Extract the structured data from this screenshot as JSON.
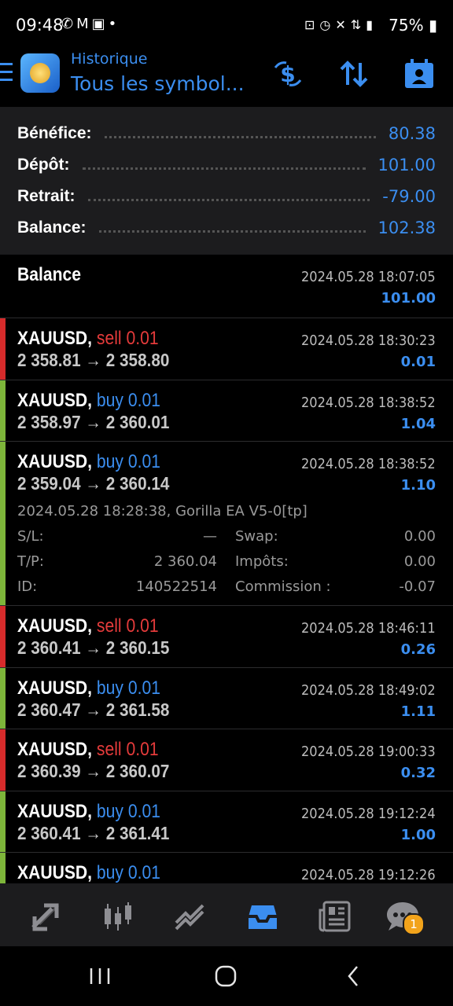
{
  "status_bar": {
    "time": "09:48",
    "battery": "75%",
    "left_icons": [
      "whatsapp-icon",
      "gmail-icon",
      "gallery-icon",
      "dot-icon"
    ],
    "right_icons": [
      "lock-icon",
      "alarm-icon",
      "mute-icon",
      "4g-icon",
      "signal-icon",
      "battery-icon"
    ]
  },
  "header": {
    "subtitle": "Historique",
    "title": "Tous les symbol...",
    "accent": "#3b8ef0"
  },
  "summary": [
    {
      "label": "Bénéfice:",
      "value": "80.38"
    },
    {
      "label": "Dépôt:",
      "value": "101.00"
    },
    {
      "label": "Retrait:",
      "value": "-79.00"
    },
    {
      "label": "Balance:",
      "value": "102.38"
    }
  ],
  "balance_entry": {
    "label": "Balance",
    "date": "2024.05.28 18:07:05",
    "amount": "101.00"
  },
  "trades": [
    {
      "symbol": "XAUUSD,",
      "action": "sell 0.01",
      "side": "sell",
      "open": "2 358.81",
      "close": "2 358.80",
      "date": "2024.05.28 18:30:23",
      "profit": "0.01"
    },
    {
      "symbol": "XAUUSD,",
      "action": "buy 0.01",
      "side": "buy",
      "open": "2 358.97",
      "close": "2 360.01",
      "date": "2024.05.28 18:38:52",
      "profit": "1.04"
    },
    {
      "symbol": "XAUUSD,",
      "action": "buy 0.01",
      "side": "buy",
      "open": "2 359.04",
      "close": "2 360.14",
      "date": "2024.05.28 18:38:52",
      "profit": "1.10",
      "details": {
        "comment": "2024.05.28 18:28:38, Gorilla EA V5-0[tp]",
        "sl_label": "S/L:",
        "sl_value": "—",
        "tp_label": "T/P:",
        "tp_value": "2 360.04",
        "id_label": "ID:",
        "id_value": "140522514",
        "swap_label": "Swap:",
        "swap_value": "0.00",
        "tax_label": "Impôts:",
        "tax_value": "0.00",
        "commission_label": "Commission :",
        "commission_value": "-0.07"
      }
    },
    {
      "symbol": "XAUUSD,",
      "action": "sell 0.01",
      "side": "sell",
      "open": "2 360.41",
      "close": "2 360.15",
      "date": "2024.05.28 18:46:11",
      "profit": "0.26"
    },
    {
      "symbol": "XAUUSD,",
      "action": "buy 0.01",
      "side": "buy",
      "open": "2 360.47",
      "close": "2 361.58",
      "date": "2024.05.28 18:49:02",
      "profit": "1.11"
    },
    {
      "symbol": "XAUUSD,",
      "action": "sell 0.01",
      "side": "sell",
      "open": "2 360.39",
      "close": "2 360.07",
      "date": "2024.05.28 19:00:33",
      "profit": "0.32"
    },
    {
      "symbol": "XAUUSD,",
      "action": "buy 0.01",
      "side": "buy",
      "open": "2 360.41",
      "close": "2 361.41",
      "date": "2024.05.28 19:12:24",
      "profit": "1.00"
    },
    {
      "symbol": "XAUUSD,",
      "action": "buy 0.01",
      "side": "buy",
      "open": "",
      "close": "",
      "date": "2024.05.28 19:12:26",
      "profit": ""
    }
  ],
  "bottom_nav": {
    "items": [
      "quotes-icon",
      "chart-icon",
      "trade-icon",
      "history-icon",
      "news-icon",
      "chat-icon"
    ],
    "active": "history-icon",
    "chat_badge": "1"
  }
}
